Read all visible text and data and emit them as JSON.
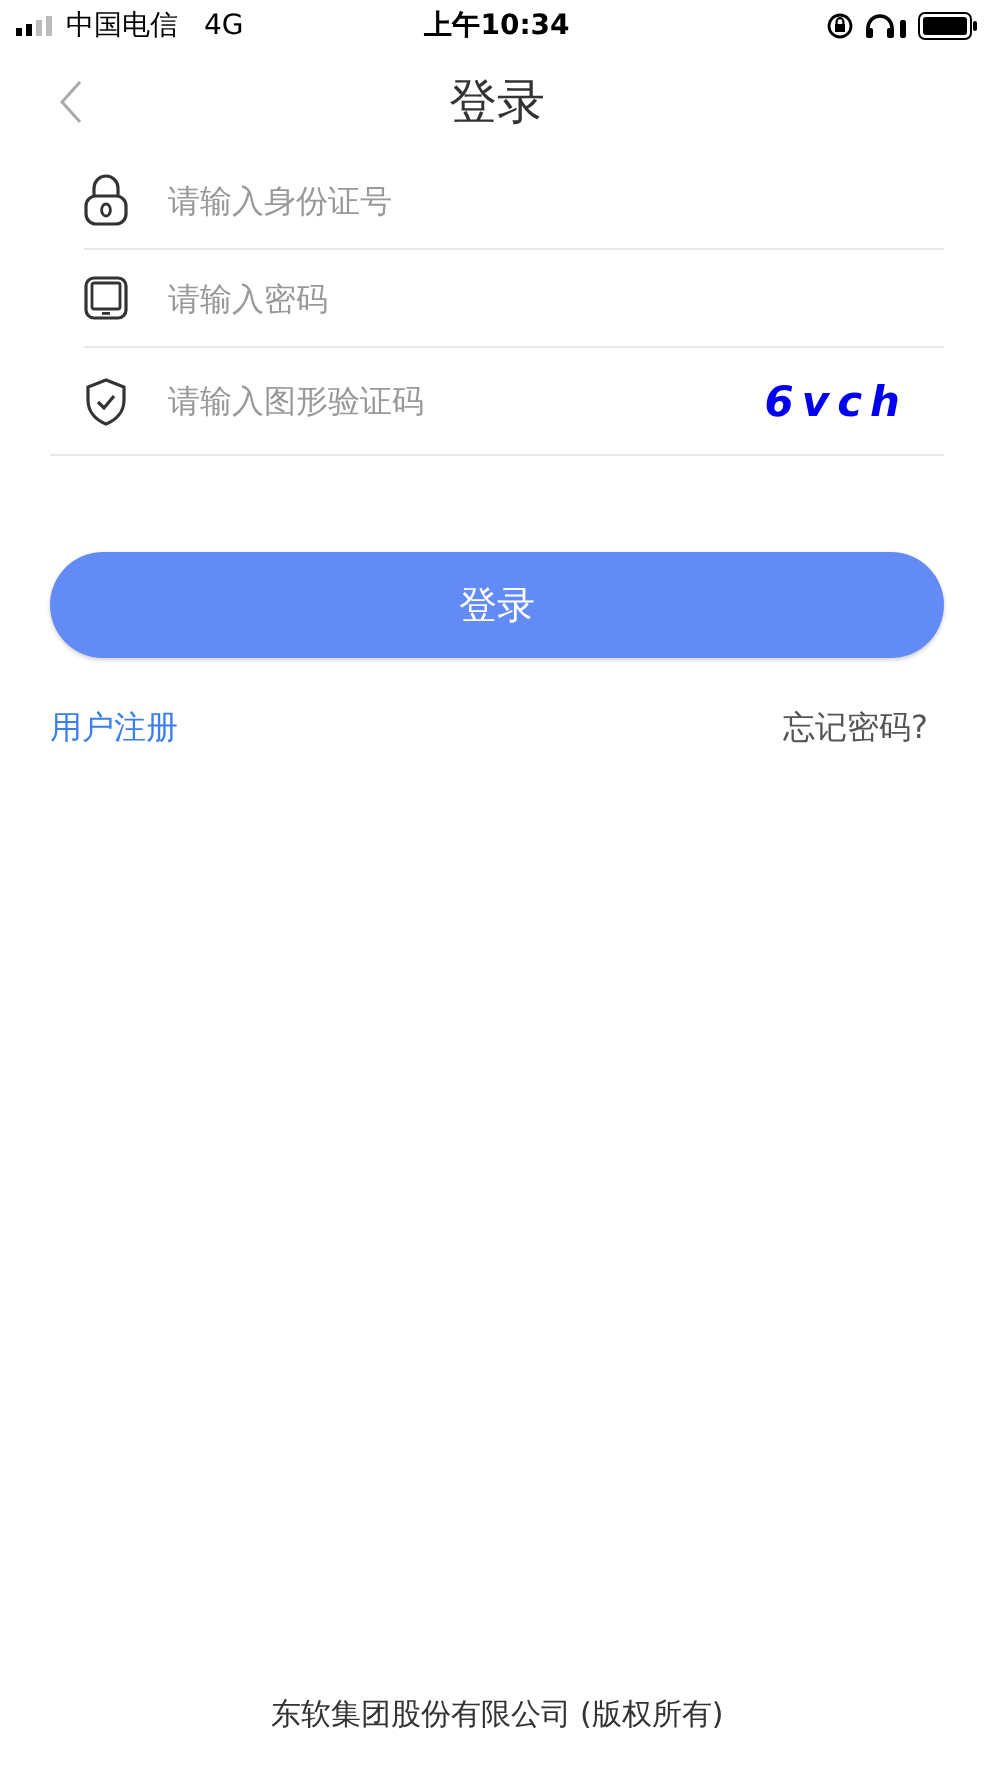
{
  "status_bar": {
    "carrier": "中国电信",
    "network": "4G",
    "time": "上午10:34"
  },
  "nav": {
    "title": "登录"
  },
  "fields": [
    {
      "kind": "lock",
      "placeholder": "请输入身份证号"
    },
    {
      "kind": "tablet",
      "placeholder": "请输入密码"
    },
    {
      "kind": "shield",
      "placeholder": "请输入图形验证码",
      "captcha": "6vch"
    }
  ],
  "login_button": "登录",
  "links": {
    "register": "用户注册",
    "forgot": "忘记密码?"
  },
  "footer": "东软集团股份有限公司 (版权所有)"
}
